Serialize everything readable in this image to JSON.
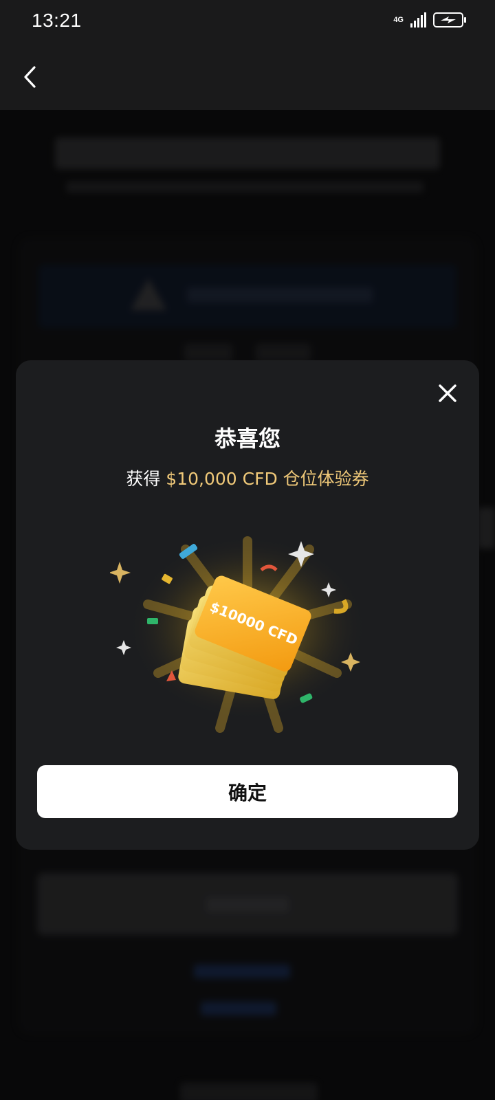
{
  "status_bar": {
    "time": "13:21",
    "network": "4G",
    "battery_state": "charging"
  },
  "header": {
    "back_icon": "chevron-left-icon"
  },
  "modal": {
    "title": "恭喜您",
    "subtitle_prefix": "获得 ",
    "subtitle_highlight": "$10,000 CFD 仓位体验券",
    "ticket_text": "$10000 CFD",
    "confirm_label": "确定",
    "close_icon": "close-icon"
  },
  "colors": {
    "background": "#0b0b0c",
    "modal_bg": "#1c1d1f",
    "highlight": "#f0c979",
    "ticket_gold": "#f5a623",
    "button_bg": "#ffffff"
  }
}
